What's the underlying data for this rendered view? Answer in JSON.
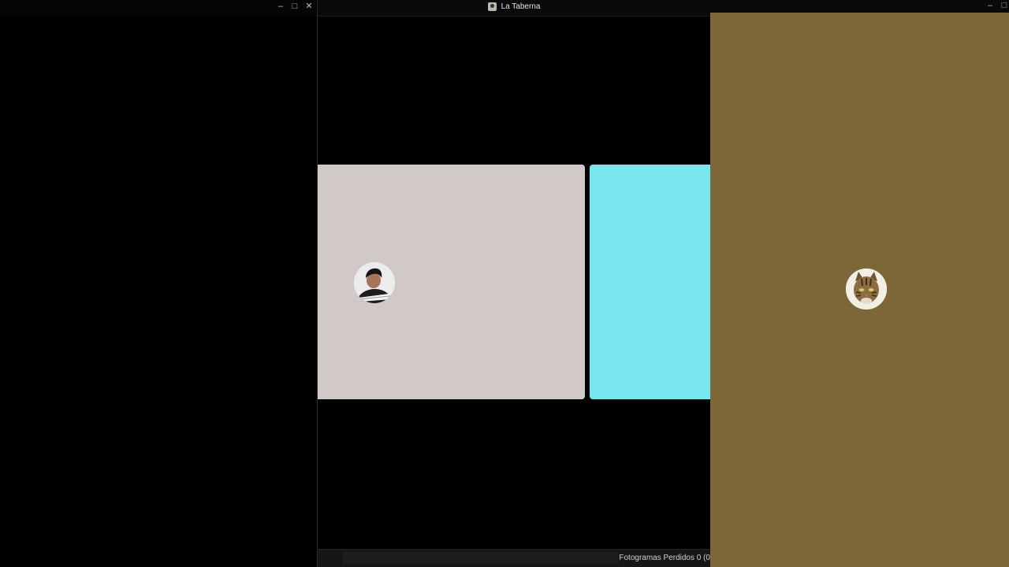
{
  "left_window": {
    "controls": {
      "minimize": "–",
      "maximize": "□",
      "close": "✕"
    }
  },
  "center_window": {
    "title": "La Taberna",
    "status": {
      "dropped_frames": "Fotogramas Perdidos 0 (0"
    },
    "tiles": [
      {
        "id": "user",
        "color": "#d1c9c7",
        "avatar": "person-avatar"
      },
      {
        "id": "cyan",
        "color": "#78e6ef"
      }
    ]
  },
  "right_window": {
    "controls": {
      "minimize": "–",
      "maximize": "□"
    },
    "background": "#7d6637",
    "avatar": "cat-avatar"
  },
  "colors": {
    "desktop": "#000000",
    "left_window_bg": "#010103",
    "statusbar_bg": "#161616"
  }
}
